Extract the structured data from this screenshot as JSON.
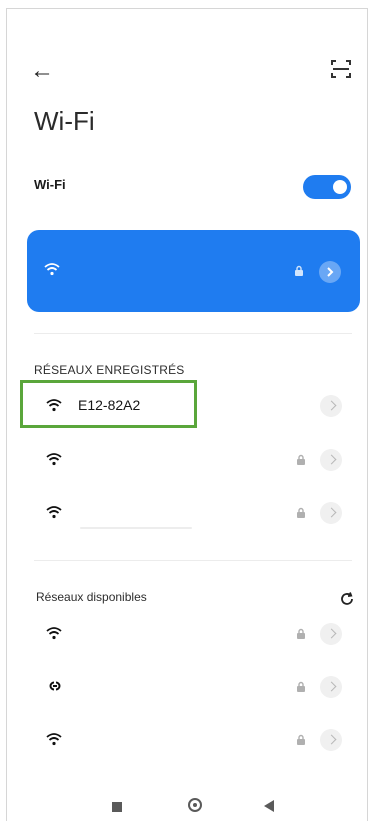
{
  "header": {
    "back_icon": "arrow-left-icon",
    "scan_icon": "qr-scan-icon",
    "title": "Wi-Fi"
  },
  "wifi_toggle": {
    "label": "Wi-Fi",
    "state": "on"
  },
  "connected_network": {
    "name": "",
    "secured": true,
    "accent_color": "#1f7cf0"
  },
  "saved_networks": {
    "title": "RÉSEAUX ENREGISTRÉS",
    "items": [
      {
        "name": "E12-82A2",
        "icon": "wifi-icon",
        "secured": false
      },
      {
        "name": "",
        "icon": "wifi-icon",
        "secured": true
      },
      {
        "name": "",
        "icon": "wifi-icon",
        "secured": true
      }
    ]
  },
  "available_networks": {
    "title": "Réseaux disponibles",
    "refresh_icon": "refresh-icon",
    "items": [
      {
        "name": "",
        "icon": "wifi-icon",
        "secured": true
      },
      {
        "name": "",
        "icon": "link-icon",
        "secured": true
      },
      {
        "name": "",
        "icon": "wifi-icon",
        "secured": true
      }
    ]
  },
  "navigation": {
    "recent_icon": "square-icon",
    "home_icon": "circle-icon",
    "back_icon": "triangle-back-icon"
  },
  "colors": {
    "accent": "#1f7cf0",
    "highlight_border": "#5aa63b"
  }
}
